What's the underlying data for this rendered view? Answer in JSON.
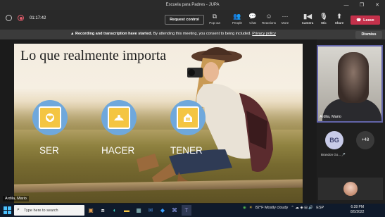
{
  "window": {
    "title": "Escuela para Padres - JUPA"
  },
  "toolbar": {
    "timer": "01:17:42",
    "request_control": "Request control",
    "buttons": [
      {
        "label": "Pop out",
        "icon": "popout-icon"
      },
      {
        "label": "People",
        "icon": "people-icon"
      },
      {
        "label": "Chat",
        "icon": "chat-icon"
      },
      {
        "label": "Reactions",
        "icon": "reactions-icon"
      },
      {
        "label": "More",
        "icon": "more-icon"
      },
      {
        "label": "Camera",
        "icon": "camera-icon"
      },
      {
        "label": "Mic",
        "icon": "mic-icon"
      },
      {
        "label": "Share",
        "icon": "share-icon"
      }
    ],
    "leave": "Leave",
    "leave_color": "#c4314b"
  },
  "banner": {
    "bold": "Recording and transcription have started.",
    "text": "By attending this meeting, you consent to being included.",
    "link": "Privacy policy",
    "dismiss": "Dismiss"
  },
  "slide": {
    "title": "Lo que realmente importa",
    "items": [
      {
        "label": "SER",
        "icon": "heart-icon"
      },
      {
        "label": "HACER",
        "icon": "hands-icon"
      },
      {
        "label": "TENER",
        "icon": "house-icon"
      }
    ],
    "circle_color": "#6fa8dc",
    "inner_color": "#f4c542"
  },
  "presenter": {
    "name": "Ardila, Mario"
  },
  "sidebar": {
    "main_tile_name": "Ardila, Mario",
    "avatar_initials": "BG",
    "avatar_name": "Brandon Go...",
    "more_count": "+48"
  },
  "taskbar": {
    "search_placeholder": "Type here to search",
    "weather": "82°F  Mostly cloudy",
    "lang": "ESP",
    "time": "6:28 PM",
    "date": "8/5/2022"
  }
}
